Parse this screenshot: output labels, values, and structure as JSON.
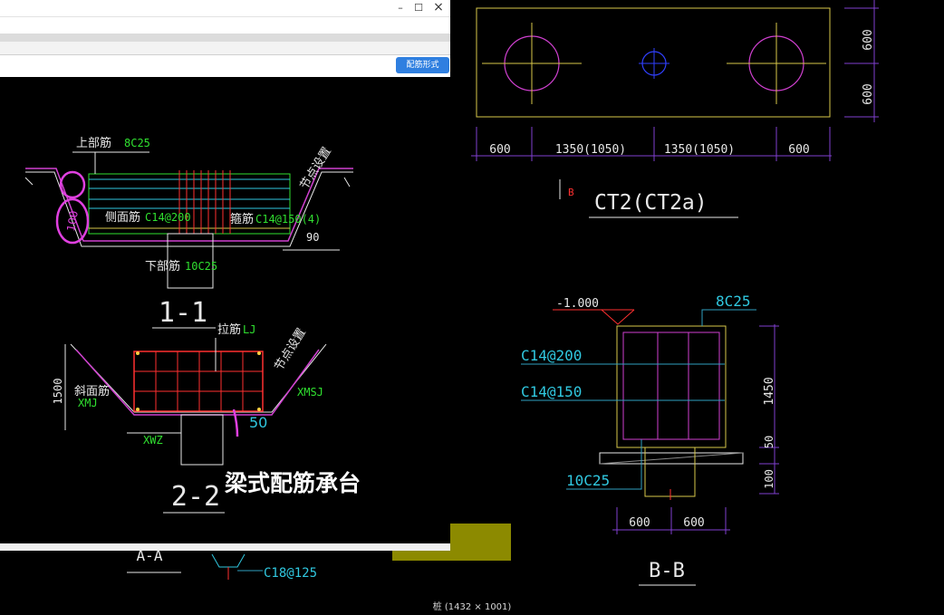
{
  "status_caption": "桩 (1432 × 1001)",
  "dialog": {
    "config_button_label": "配筋形式",
    "window_buttons": {
      "minimize": "–",
      "maximize": "☐",
      "close": "×"
    },
    "section1": {
      "top_bar": "上部筋",
      "top_bar_value": "8C25",
      "side_bar": "侧面筋",
      "side_bar_value": "C14@200",
      "stirrup": "箍筋",
      "stirrup_value": "C14@150(4)",
      "bottom_bar": "下部筋",
      "bottom_bar_value": "10C25",
      "node_setting": "节点设置",
      "angle": "90",
      "handwritten": "100",
      "section_title": "1-1"
    },
    "section2": {
      "tie_bar": "拉筋",
      "tie_bar_value": "LJ",
      "slope_bar": "斜面筋",
      "slope_left": "XMJ",
      "slope_right": "XMSJ",
      "node_setting": "节点设置",
      "bottom_label": "XWZ",
      "height": "1500",
      "annot_value": "50",
      "section_title": "2-2",
      "caption": "梁式配筋承台"
    }
  },
  "cad": {
    "plan": {
      "dims_right": [
        "600",
        "600"
      ],
      "dims_bottom": [
        "600",
        "1350(1050)",
        "1350(1050)",
        "600"
      ],
      "label": "CT2(CT2a)",
      "marker": "B"
    },
    "section_bb": {
      "elevation": "-1.000",
      "top_bar": "8C25",
      "side_bar": "C14@200",
      "stirrup": "C14@150",
      "bottom_bar": "10C25",
      "dims_right": [
        "1450",
        "50",
        "100"
      ],
      "dims_bottom": [
        "600",
        "600"
      ],
      "title": "B-B"
    },
    "below": {
      "label_a": "A-A",
      "label_c": "C18@125"
    }
  }
}
